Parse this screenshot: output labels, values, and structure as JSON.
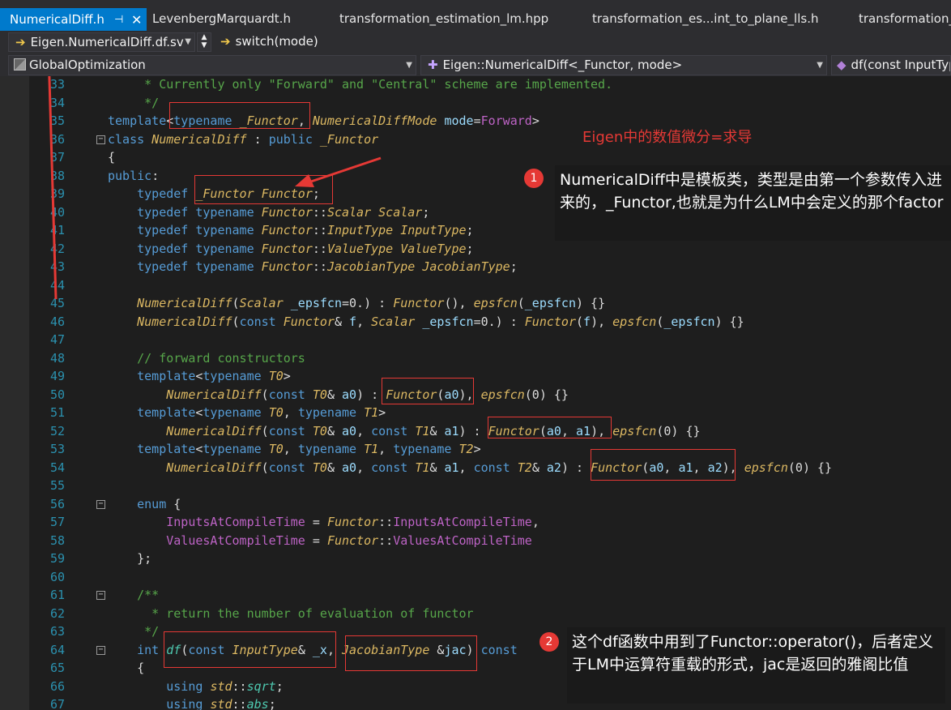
{
  "tabs": [
    {
      "label": "NumericalDiff.h",
      "active": true
    },
    {
      "label": "LevenbergMarquardt.h"
    },
    {
      "label": "transformation_estimation_lm.hpp"
    },
    {
      "label": "transformation_es...int_to_plane_lls.h"
    },
    {
      "label": "transformation_"
    }
  ],
  "tab_icons": {
    "pin": "pin-icon",
    "close": "close-icon"
  },
  "nav": {
    "member": "Eigen.NumericalDiff.df.sv",
    "function": "switch(mode)"
  },
  "scope": {
    "project": "GlobalOptimization",
    "class": "Eigen::NumericalDiff<_Functor, mode>",
    "member": "df(const InputTyp"
  },
  "annotations": {
    "title": "Eigen中的数值微分=求导",
    "note1_badge": "1",
    "note1": "NumericalDiff中是模板类，类型是由第一个参数传入进来的，_Functor,也就是为什么LM中会定义的那个factor",
    "note2_badge": "2",
    "note2": "这个df函数中用到了Functor::operator()，后者定义于LM中运算符重载的形式，jac是返回的雅阁比值"
  },
  "code_lines": [
    {
      "n": "33",
      "segs": [
        [
          "cm",
          "     * Currently only \"Forward\" and \"Central\" scheme are implemented."
        ]
      ]
    },
    {
      "n": "34",
      "segs": [
        [
          "cm",
          "     */"
        ]
      ]
    },
    {
      "n": "35",
      "segs": [
        [
          "kw",
          "template"
        ],
        [
          "",
          "<"
        ],
        [
          "kw",
          "typename"
        ],
        [
          "",
          " "
        ],
        [
          "ty",
          "_Functor"
        ],
        [
          "",
          ", "
        ],
        [
          "ty",
          "NumericalDiffMode"
        ],
        [
          "",
          " "
        ],
        [
          "pr",
          "mode"
        ],
        [
          "",
          "="
        ],
        [
          "ma",
          "Forward"
        ],
        [
          "",
          ">"
        ]
      ]
    },
    {
      "n": "36",
      "segs": [
        [
          "kw",
          "class"
        ],
        [
          "",
          " "
        ],
        [
          "ty",
          "NumericalDiff"
        ],
        [
          "",
          " : "
        ],
        [
          "kw",
          "public"
        ],
        [
          "",
          " "
        ],
        [
          "ty",
          "_Functor"
        ]
      ]
    },
    {
      "n": "37",
      "segs": [
        [
          "",
          "{"
        ]
      ]
    },
    {
      "n": "38",
      "segs": [
        [
          "kw",
          "public"
        ],
        [
          "",
          ":"
        ]
      ]
    },
    {
      "n": "39",
      "segs": [
        [
          "",
          "    "
        ],
        [
          "kw",
          "typedef"
        ],
        [
          "",
          " "
        ],
        [
          "ty",
          "_Functor"
        ],
        [
          "",
          " "
        ],
        [
          "ty",
          "Functor"
        ],
        [
          "",
          ";"
        ]
      ]
    },
    {
      "n": "40",
      "segs": [
        [
          "",
          "    "
        ],
        [
          "kw",
          "typedef"
        ],
        [
          "",
          " "
        ],
        [
          "kw",
          "typename"
        ],
        [
          "",
          " "
        ],
        [
          "ty",
          "Functor"
        ],
        [
          "",
          "::"
        ],
        [
          "ty",
          "Scalar"
        ],
        [
          "",
          " "
        ],
        [
          "ty",
          "Scalar"
        ],
        [
          "",
          ";"
        ]
      ]
    },
    {
      "n": "41",
      "segs": [
        [
          "",
          "    "
        ],
        [
          "kw",
          "typedef"
        ],
        [
          "",
          " "
        ],
        [
          "kw",
          "typename"
        ],
        [
          "",
          " "
        ],
        [
          "ty",
          "Functor"
        ],
        [
          "",
          "::"
        ],
        [
          "ty",
          "InputType"
        ],
        [
          "",
          " "
        ],
        [
          "ty",
          "InputType"
        ],
        [
          "",
          ";"
        ]
      ]
    },
    {
      "n": "42",
      "segs": [
        [
          "",
          "    "
        ],
        [
          "kw",
          "typedef"
        ],
        [
          "",
          " "
        ],
        [
          "kw",
          "typename"
        ],
        [
          "",
          " "
        ],
        [
          "ty",
          "Functor"
        ],
        [
          "",
          "::"
        ],
        [
          "ty",
          "ValueType"
        ],
        [
          "",
          " "
        ],
        [
          "ty",
          "ValueType"
        ],
        [
          "",
          ";"
        ]
      ]
    },
    {
      "n": "43",
      "segs": [
        [
          "",
          "    "
        ],
        [
          "kw",
          "typedef"
        ],
        [
          "",
          " "
        ],
        [
          "kw",
          "typename"
        ],
        [
          "",
          " "
        ],
        [
          "ty",
          "Functor"
        ],
        [
          "",
          "::"
        ],
        [
          "ty",
          "JacobianType"
        ],
        [
          "",
          " "
        ],
        [
          "ty",
          "JacobianType"
        ],
        [
          "",
          ";"
        ]
      ]
    },
    {
      "n": "44",
      "segs": []
    },
    {
      "n": "45",
      "segs": [
        [
          "",
          "    "
        ],
        [
          "fn",
          "NumericalDiff"
        ],
        [
          "",
          "("
        ],
        [
          "ty",
          "Scalar"
        ],
        [
          "",
          " "
        ],
        [
          "pr",
          "_epsfcn"
        ],
        [
          "",
          "=0.) : "
        ],
        [
          "fn",
          "Functor"
        ],
        [
          "",
          "(), "
        ],
        [
          "fn",
          "epsfcn"
        ],
        [
          "",
          "("
        ],
        [
          "pr",
          "_epsfcn"
        ],
        [
          "",
          ") {}"
        ]
      ]
    },
    {
      "n": "46",
      "segs": [
        [
          "",
          "    "
        ],
        [
          "fn",
          "NumericalDiff"
        ],
        [
          "",
          "("
        ],
        [
          "kw",
          "const"
        ],
        [
          "",
          " "
        ],
        [
          "ty",
          "Functor"
        ],
        [
          "",
          "& "
        ],
        [
          "pr",
          "f"
        ],
        [
          "",
          ", "
        ],
        [
          "ty",
          "Scalar"
        ],
        [
          "",
          " "
        ],
        [
          "pr",
          "_epsfcn"
        ],
        [
          "",
          "=0.) : "
        ],
        [
          "fn",
          "Functor"
        ],
        [
          "",
          "("
        ],
        [
          "pr",
          "f"
        ],
        [
          "",
          "), "
        ],
        [
          "fn",
          "epsfcn"
        ],
        [
          "",
          "("
        ],
        [
          "pr",
          "_epsfcn"
        ],
        [
          "",
          ") {}"
        ]
      ]
    },
    {
      "n": "47",
      "segs": []
    },
    {
      "n": "48",
      "segs": [
        [
          "",
          "    "
        ],
        [
          "cm",
          "// forward constructors"
        ]
      ]
    },
    {
      "n": "49",
      "segs": [
        [
          "",
          "    "
        ],
        [
          "kw",
          "template"
        ],
        [
          "",
          "<"
        ],
        [
          "kw",
          "typename"
        ],
        [
          "",
          " "
        ],
        [
          "ty",
          "T0"
        ],
        [
          "",
          ">"
        ]
      ]
    },
    {
      "n": "50",
      "segs": [
        [
          "",
          "        "
        ],
        [
          "fn",
          "NumericalDiff"
        ],
        [
          "",
          "("
        ],
        [
          "kw",
          "const"
        ],
        [
          "",
          " "
        ],
        [
          "ty",
          "T0"
        ],
        [
          "",
          "& "
        ],
        [
          "pr",
          "a0"
        ],
        [
          "",
          ") : "
        ],
        [
          "fn",
          "Functor"
        ],
        [
          "",
          "("
        ],
        [
          "pr",
          "a0"
        ],
        [
          "",
          "), "
        ],
        [
          "fn",
          "epsfcn"
        ],
        [
          "",
          "(0) {}"
        ]
      ]
    },
    {
      "n": "51",
      "segs": [
        [
          "",
          "    "
        ],
        [
          "kw",
          "template"
        ],
        [
          "",
          "<"
        ],
        [
          "kw",
          "typename"
        ],
        [
          "",
          " "
        ],
        [
          "ty",
          "T0"
        ],
        [
          "",
          ", "
        ],
        [
          "kw",
          "typename"
        ],
        [
          "",
          " "
        ],
        [
          "ty",
          "T1"
        ],
        [
          "",
          ">"
        ]
      ]
    },
    {
      "n": "52",
      "segs": [
        [
          "",
          "        "
        ],
        [
          "fn",
          "NumericalDiff"
        ],
        [
          "",
          "("
        ],
        [
          "kw",
          "const"
        ],
        [
          "",
          " "
        ],
        [
          "ty",
          "T0"
        ],
        [
          "",
          "& "
        ],
        [
          "pr",
          "a0"
        ],
        [
          "",
          ", "
        ],
        [
          "kw",
          "const"
        ],
        [
          "",
          " "
        ],
        [
          "ty",
          "T1"
        ],
        [
          "",
          "& "
        ],
        [
          "pr",
          "a1"
        ],
        [
          "",
          ") : "
        ],
        [
          "fn",
          "Functor"
        ],
        [
          "",
          "("
        ],
        [
          "pr",
          "a0"
        ],
        [
          "",
          ", "
        ],
        [
          "pr",
          "a1"
        ],
        [
          "",
          "), "
        ],
        [
          "fn",
          "epsfcn"
        ],
        [
          "",
          "(0) {}"
        ]
      ]
    },
    {
      "n": "53",
      "segs": [
        [
          "",
          "    "
        ],
        [
          "kw",
          "template"
        ],
        [
          "",
          "<"
        ],
        [
          "kw",
          "typename"
        ],
        [
          "",
          " "
        ],
        [
          "ty",
          "T0"
        ],
        [
          "",
          ", "
        ],
        [
          "kw",
          "typename"
        ],
        [
          "",
          " "
        ],
        [
          "ty",
          "T1"
        ],
        [
          "",
          ", "
        ],
        [
          "kw",
          "typename"
        ],
        [
          "",
          " "
        ],
        [
          "ty",
          "T2"
        ],
        [
          "",
          ">"
        ]
      ]
    },
    {
      "n": "54",
      "segs": [
        [
          "",
          "        "
        ],
        [
          "fn",
          "NumericalDiff"
        ],
        [
          "",
          "("
        ],
        [
          "kw",
          "const"
        ],
        [
          "",
          " "
        ],
        [
          "ty",
          "T0"
        ],
        [
          "",
          "& "
        ],
        [
          "pr",
          "a0"
        ],
        [
          "",
          ", "
        ],
        [
          "kw",
          "const"
        ],
        [
          "",
          " "
        ],
        [
          "ty",
          "T1"
        ],
        [
          "",
          "& "
        ],
        [
          "pr",
          "a1"
        ],
        [
          "",
          ", "
        ],
        [
          "kw",
          "const"
        ],
        [
          "",
          " "
        ],
        [
          "ty",
          "T2"
        ],
        [
          "",
          "& "
        ],
        [
          "pr",
          "a2"
        ],
        [
          "",
          ") : "
        ],
        [
          "fn",
          "Functor"
        ],
        [
          "",
          "("
        ],
        [
          "pr",
          "a0"
        ],
        [
          "",
          ", "
        ],
        [
          "pr",
          "a1"
        ],
        [
          "",
          ", "
        ],
        [
          "pr",
          "a2"
        ],
        [
          "",
          "), "
        ],
        [
          "fn",
          "epsfcn"
        ],
        [
          "",
          "(0) {}"
        ]
      ]
    },
    {
      "n": "55",
      "segs": []
    },
    {
      "n": "56",
      "segs": [
        [
          "",
          "    "
        ],
        [
          "kw",
          "enum"
        ],
        [
          "",
          " {"
        ]
      ]
    },
    {
      "n": "57",
      "segs": [
        [
          "",
          "        "
        ],
        [
          "ma",
          "InputsAtCompileTime"
        ],
        [
          "",
          " = "
        ],
        [
          "ty",
          "Functor"
        ],
        [
          "",
          "::"
        ],
        [
          "ma",
          "InputsAtCompileTime"
        ],
        [
          "",
          ","
        ]
      ]
    },
    {
      "n": "58",
      "segs": [
        [
          "",
          "        "
        ],
        [
          "ma",
          "ValuesAtCompileTime"
        ],
        [
          "",
          " = "
        ],
        [
          "ty",
          "Functor"
        ],
        [
          "",
          "::"
        ],
        [
          "ma",
          "ValuesAtCompileTime"
        ]
      ]
    },
    {
      "n": "59",
      "segs": [
        [
          "",
          "    };"
        ]
      ]
    },
    {
      "n": "60",
      "segs": []
    },
    {
      "n": "61",
      "segs": [
        [
          "",
          "    "
        ],
        [
          "cm",
          "/**"
        ]
      ]
    },
    {
      "n": "62",
      "segs": [
        [
          "",
          "    "
        ],
        [
          "cm",
          "  * return the number of evaluation of functor"
        ]
      ]
    },
    {
      "n": "63",
      "segs": [
        [
          "",
          "    "
        ],
        [
          "cm",
          " */"
        ]
      ]
    },
    {
      "n": "64",
      "segs": [
        [
          "",
          "    "
        ],
        [
          "kw",
          "int"
        ],
        [
          "",
          " "
        ],
        [
          "fnb",
          "df"
        ],
        [
          "",
          "("
        ],
        [
          "kw",
          "const"
        ],
        [
          "",
          " "
        ],
        [
          "ty",
          "InputType"
        ],
        [
          "",
          "& "
        ],
        [
          "pr",
          "_x"
        ],
        [
          "",
          ", "
        ],
        [
          "ty",
          "JacobianType"
        ],
        [
          "",
          " &"
        ],
        [
          "pr",
          "jac"
        ],
        [
          "",
          ") "
        ],
        [
          "kw",
          "const"
        ]
      ]
    },
    {
      "n": "65",
      "segs": [
        [
          "",
          "    {"
        ]
      ]
    },
    {
      "n": "66",
      "segs": [
        [
          "",
          "        "
        ],
        [
          "kw",
          "using"
        ],
        [
          "",
          " "
        ],
        [
          "ty",
          "std"
        ],
        [
          "",
          "::"
        ],
        [
          "fnb",
          "sqrt"
        ],
        [
          "",
          ";"
        ]
      ]
    },
    {
      "n": "67",
      "segs": [
        [
          "",
          "        "
        ],
        [
          "kw",
          "using"
        ],
        [
          "",
          " "
        ],
        [
          "ty",
          "std"
        ],
        [
          "",
          "::"
        ],
        [
          "fnb",
          "abs"
        ],
        [
          "",
          ";"
        ]
      ]
    }
  ]
}
